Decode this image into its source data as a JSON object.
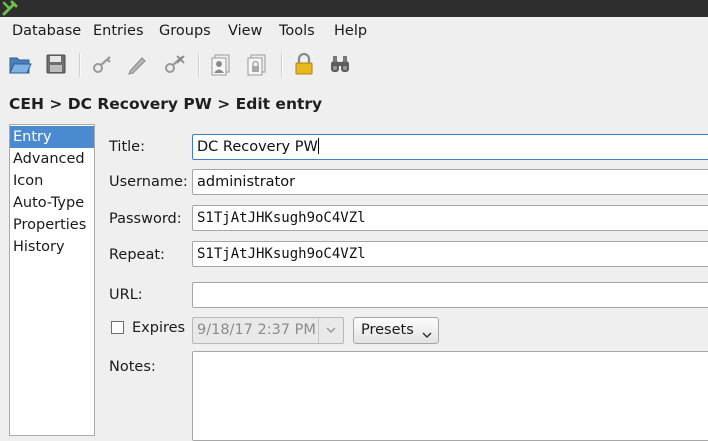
{
  "app": {
    "icon": "keepassx-icon"
  },
  "menu": [
    "Database",
    "Entries",
    "Groups",
    "View",
    "Tools",
    "Help"
  ],
  "toolbar": {
    "items": [
      "open-database-icon",
      "save-database-icon",
      "add-entry-icon",
      "edit-entry-icon",
      "delete-entry-icon",
      "copy-username-icon",
      "copy-password-icon",
      "lock-database-icon",
      "password-generator-icon"
    ]
  },
  "breadcrumb": "CEH > DC Recovery PW > Edit entry",
  "sidebar": {
    "items": [
      {
        "label": "Entry",
        "active": true
      },
      {
        "label": "Advanced"
      },
      {
        "label": "Icon"
      },
      {
        "label": "Auto-Type"
      },
      {
        "label": "Properties"
      },
      {
        "label": "History"
      }
    ]
  },
  "form": {
    "title": {
      "label": "Title:",
      "value": "DC Recovery PW"
    },
    "username": {
      "label": "Username:",
      "value": "administrator"
    },
    "password": {
      "label": "Password:",
      "value": "S1TjAtJHKsugh9oC4VZl"
    },
    "repeat": {
      "label": "Repeat:",
      "value": "S1TjAtJHKsugh9oC4VZl"
    },
    "url": {
      "label": "URL:",
      "value": ""
    },
    "expires": {
      "label": "Expires",
      "checked": false,
      "date": "9/18/17 2:37 PM",
      "presets_label": "Presets"
    },
    "notes": {
      "label": "Notes:",
      "value": ""
    }
  },
  "colors": {
    "selection": "#4a8ad0",
    "focus_border": "#3f7fc9",
    "titlebar": "#2e2e2e"
  }
}
